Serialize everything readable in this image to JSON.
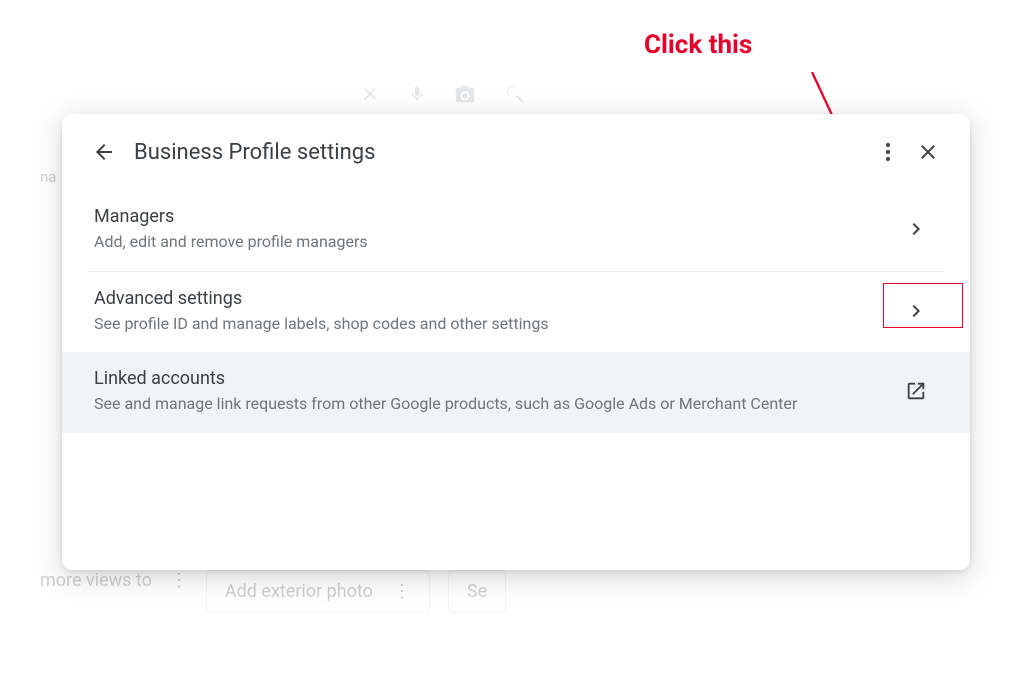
{
  "annotation": {
    "label": "Click this"
  },
  "background": {
    "bottom_text": "more views to",
    "bottom_pill": "Add exterior photo",
    "side_text": "na"
  },
  "dialog": {
    "title": "Business Profile settings",
    "rows": [
      {
        "title": "Managers",
        "subtitle": "Add, edit and remove profile managers"
      },
      {
        "title": "Advanced settings",
        "subtitle": "See profile ID and manage labels, shop codes and other settings"
      },
      {
        "title": "Linked accounts",
        "subtitle": "See and manage link requests from other Google products, such as Google Ads or Merchant Center"
      }
    ]
  }
}
